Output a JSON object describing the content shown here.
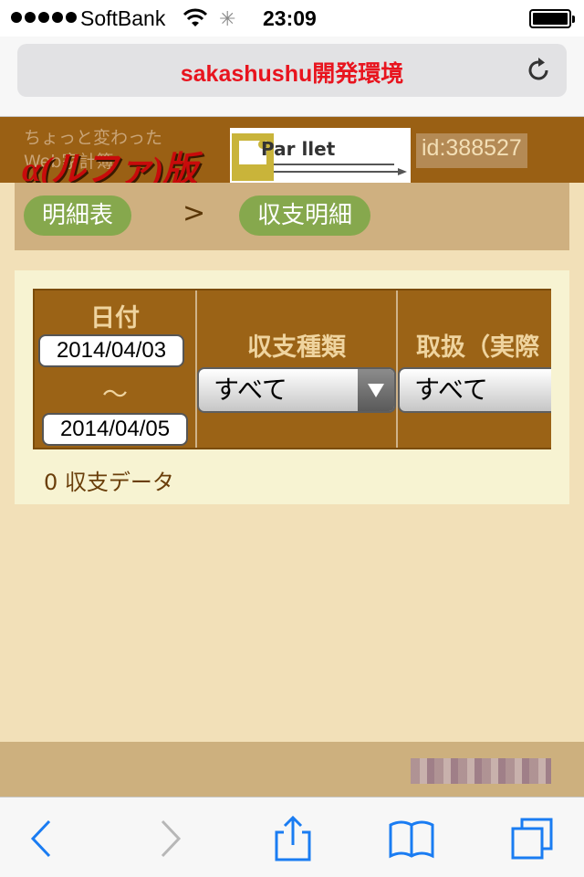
{
  "status_bar": {
    "carrier": "SoftBank",
    "time": "23:09",
    "icons": [
      "signal-icon",
      "wifi-icon",
      "activity-spinner-icon",
      "battery-icon"
    ]
  },
  "url_bar": {
    "title": "sakashushu開発環境",
    "reload_icon": "reload-icon"
  },
  "site_header": {
    "tagline": "ちょっと変わった\nWeb家計簿",
    "logo_text": "α(ルファ)版",
    "partner_logo_text": "Par llet",
    "user_id": "id:388527"
  },
  "breadcrumb": {
    "items": [
      {
        "label": "明細表"
      },
      {
        "label": "収支明細"
      }
    ],
    "separator": ">"
  },
  "filters": {
    "date": {
      "header": "日付",
      "from": "2014/04/03",
      "tilde": "～",
      "to": "2014/04/05"
    },
    "kind": {
      "header": "収支種類",
      "selected": "すべて"
    },
    "handling": {
      "header": "取扱（実際",
      "selected": "すべて"
    }
  },
  "result_count": "0 収支データ",
  "colors": {
    "url_title": "#e8141e",
    "header_bg": "#9a6014",
    "pill_bg": "#86a84d",
    "page_bg": "#f2e0b8"
  },
  "toolbar": {
    "icons": [
      "back-icon",
      "forward-icon",
      "share-icon",
      "bookmarks-icon",
      "tabs-icon"
    ]
  }
}
